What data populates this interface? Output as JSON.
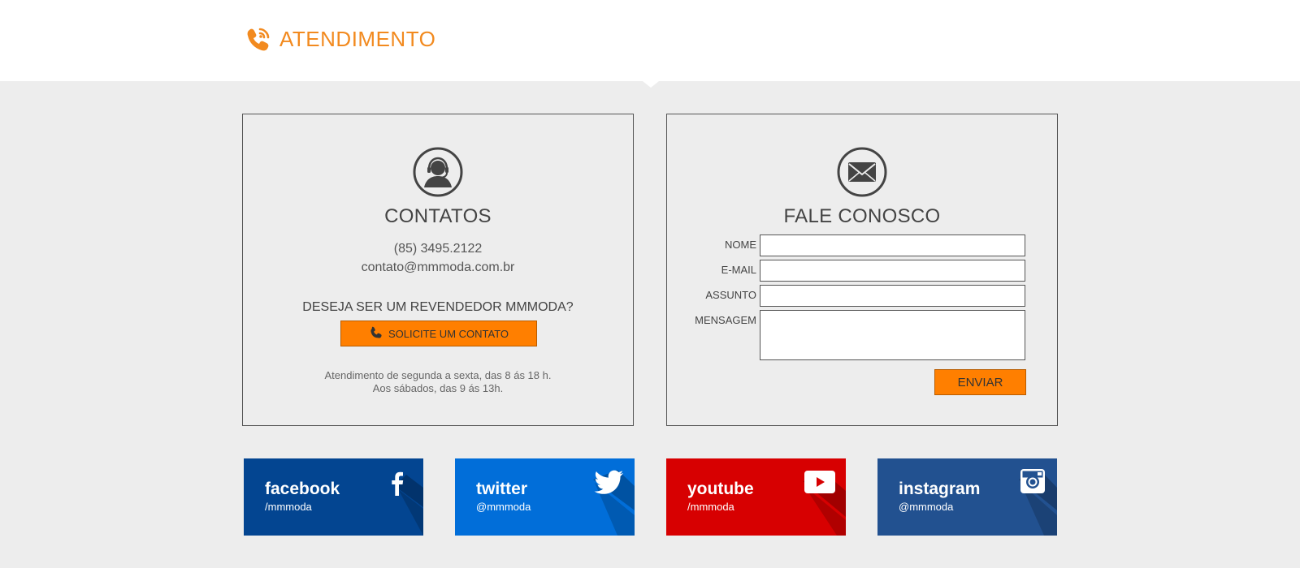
{
  "header": {
    "title": "ATENDIMENTO",
    "icon": "phone-signal-icon",
    "accent_color": "#f28a1f"
  },
  "contacts": {
    "icon": "support-agent-icon",
    "title": "CONTATOS",
    "phone": "(85) 3495.2122",
    "email": "contato@mmmoda.com.br",
    "reseller_question": "DESEJA SER UM REVENDEDOR MMMODA?",
    "button_label": "SOLICITE UM CONTATO",
    "button_icon": "phone-icon",
    "hours_weekdays": "Atendimento de segunda a sexta, das 8 ás 18 h.",
    "hours_saturday": "Aos sábados, das 9 ás 13h."
  },
  "contact_form": {
    "icon": "envelope-icon",
    "title": "FALE CONOSCO",
    "fields": {
      "name_label": "NOME",
      "name_value": "",
      "email_label": "E-MAIL",
      "email_value": "",
      "subject_label": "ASSUNTO",
      "subject_value": "",
      "message_label": "MENSAGEM",
      "message_value": ""
    },
    "submit_label": "ENVIAR",
    "button_color": "#ff7f00"
  },
  "social": [
    {
      "name": "facebook",
      "handle": "/mmmoda",
      "icon": "facebook-icon",
      "color": "#034591"
    },
    {
      "name": "twitter",
      "handle": "@mmmoda",
      "icon": "twitter-icon",
      "color": "#016ed9"
    },
    {
      "name": "youtube",
      "handle": "/mmmoda",
      "icon": "youtube-icon",
      "color": "#d70001"
    },
    {
      "name": "instagram",
      "handle": "@mmmoda",
      "icon": "instagram-icon",
      "color": "#225190"
    }
  ]
}
